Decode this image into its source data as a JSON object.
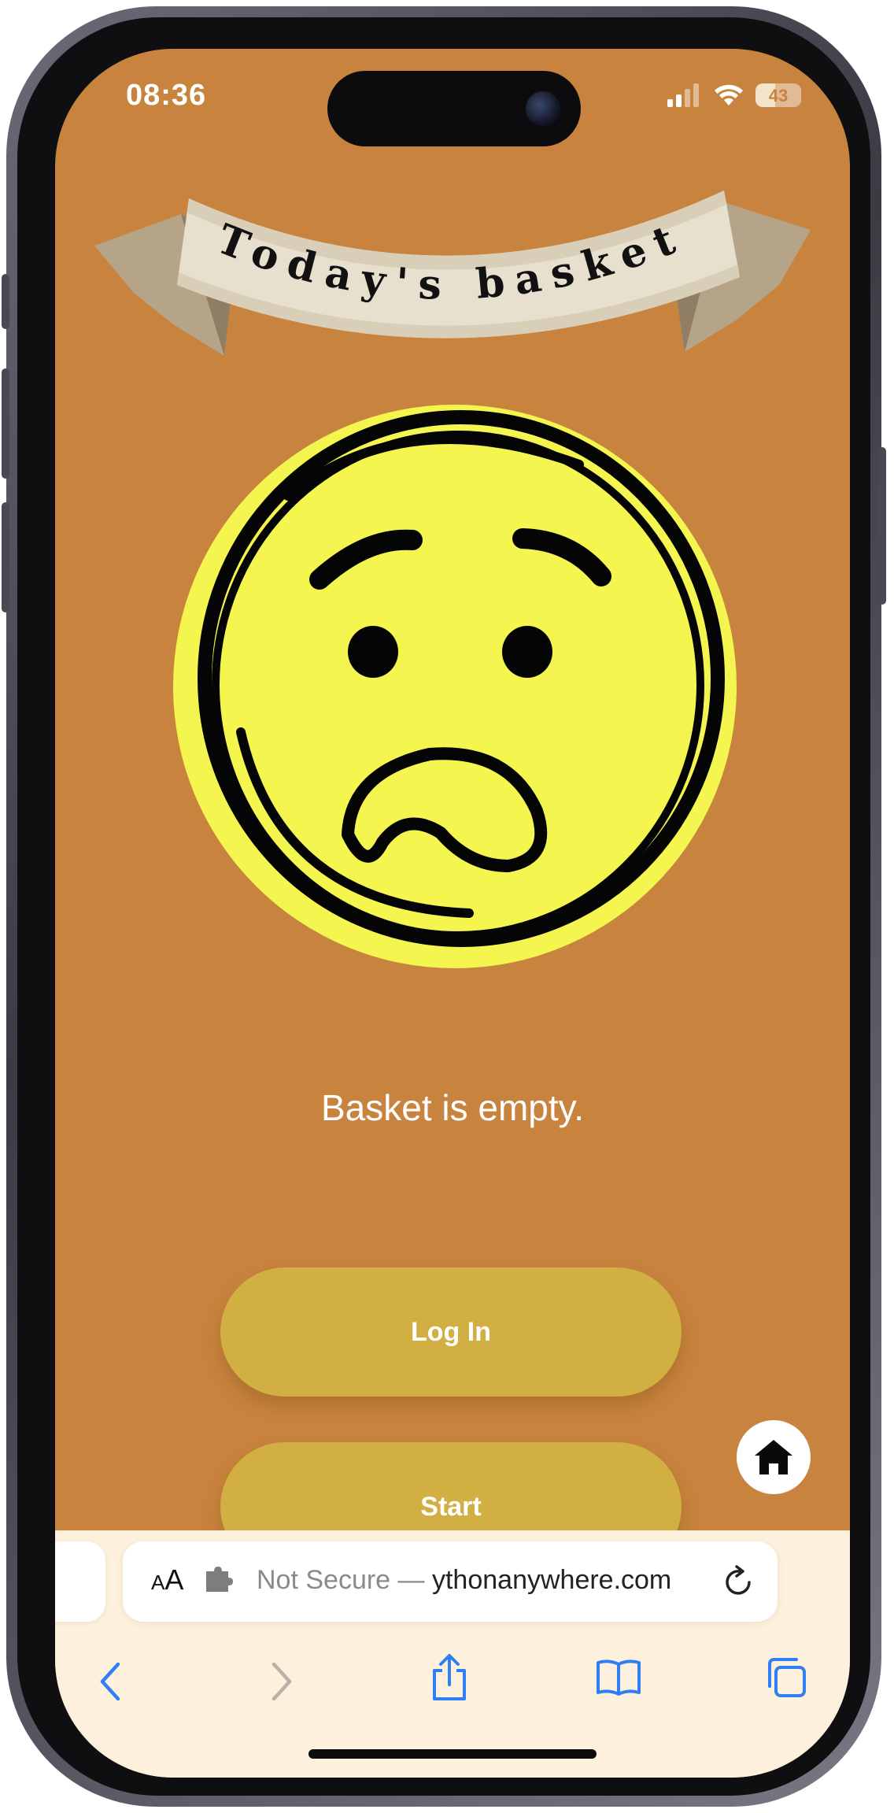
{
  "status_bar": {
    "time": "08:36",
    "battery_level": "43",
    "battery_fraction": 0.43
  },
  "banner": {
    "title": "Today's basket"
  },
  "face": {
    "icon": "sad-face-icon",
    "fill_color": "#f5f550"
  },
  "main": {
    "empty_message": "Basket is empty.",
    "login_label": "Log In",
    "start_label": "Start",
    "background_color": "#c8843e",
    "button_color": "#d2af42"
  },
  "home_fab": {
    "icon": "home-icon"
  },
  "browser": {
    "text_size_label_small": "A",
    "text_size_label_large": "A",
    "url_prefix": "Not Secure — ",
    "url_host": "ythonanywhere.com",
    "toolbar": [
      "back-icon",
      "forward-icon",
      "share-icon",
      "bookmarks-icon",
      "tabs-icon"
    ]
  }
}
